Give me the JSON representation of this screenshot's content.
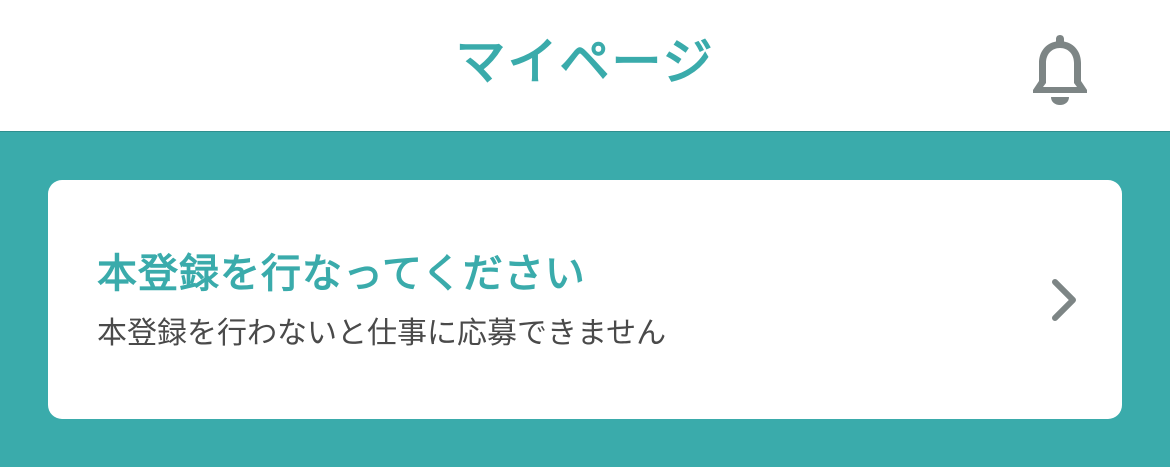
{
  "header": {
    "title": "マイページ",
    "notification_icon": "bell-icon"
  },
  "registration_card": {
    "title": "本登録を行なってください",
    "subtitle": "本登録を行わないと仕事に応募できません",
    "arrow_icon": "chevron-right-icon"
  },
  "colors": {
    "accent": "#3aabab",
    "background": "#3aabab",
    "card_background": "#ffffff",
    "subtitle_text": "#4a4a4a",
    "icon_gray": "#7d8585"
  }
}
